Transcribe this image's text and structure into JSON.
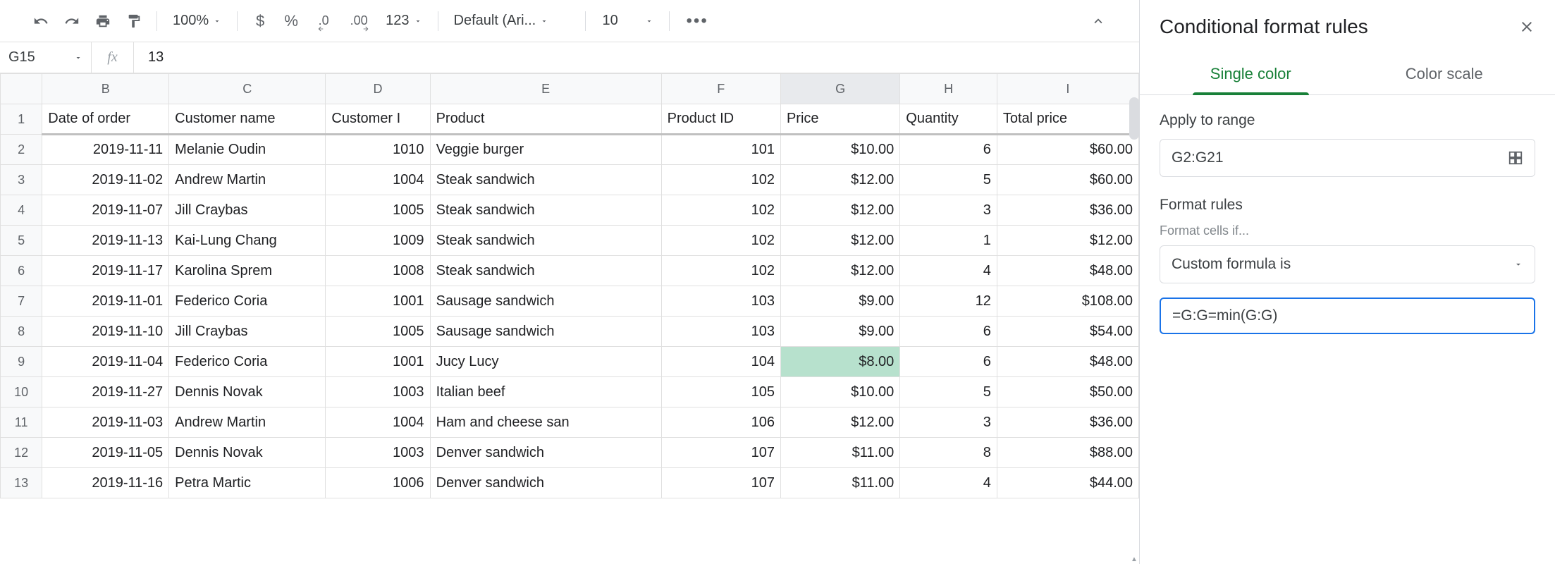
{
  "toolbar": {
    "zoom": "100%",
    "currency": "$",
    "percent": "%",
    "dec_decrease": ".0",
    "dec_increase": ".00",
    "format123": "123",
    "font": "Default (Ari...",
    "font_size": "10"
  },
  "name_box": "G15",
  "fx_label": "fx",
  "formula_value": "13",
  "columns": [
    "B",
    "C",
    "D",
    "E",
    "F",
    "G",
    "H",
    "I"
  ],
  "active_column": "G",
  "headers": [
    "Date of order",
    "Customer name",
    "Customer I",
    "Product",
    "Product ID",
    "Price",
    "Quantity",
    "Total price"
  ],
  "rows": [
    {
      "n": "1"
    },
    {
      "n": "2",
      "cells": [
        "2019-11-11",
        "Melanie Oudin",
        "1010",
        "Veggie burger",
        "101",
        "$10.00",
        "6",
        "$60.00"
      ]
    },
    {
      "n": "3",
      "cells": [
        "2019-11-02",
        "Andrew Martin",
        "1004",
        "Steak sandwich",
        "102",
        "$12.00",
        "5",
        "$60.00"
      ]
    },
    {
      "n": "4",
      "cells": [
        "2019-11-07",
        "Jill Craybas",
        "1005",
        "Steak sandwich",
        "102",
        "$12.00",
        "3",
        "$36.00"
      ]
    },
    {
      "n": "5",
      "cells": [
        "2019-11-13",
        "Kai-Lung Chang",
        "1009",
        "Steak sandwich",
        "102",
        "$12.00",
        "1",
        "$12.00"
      ]
    },
    {
      "n": "6",
      "cells": [
        "2019-11-17",
        "Karolina Sprem",
        "1008",
        "Steak sandwich",
        "102",
        "$12.00",
        "4",
        "$48.00"
      ]
    },
    {
      "n": "7",
      "cells": [
        "2019-11-01",
        "Federico Coria",
        "1001",
        "Sausage sandwich",
        "103",
        "$9.00",
        "12",
        "$108.00"
      ]
    },
    {
      "n": "8",
      "cells": [
        "2019-11-10",
        "Jill Craybas",
        "1005",
        "Sausage sandwich",
        "103",
        "$9.00",
        "6",
        "$54.00"
      ]
    },
    {
      "n": "9",
      "cells": [
        "2019-11-04",
        "Federico Coria",
        "1001",
        "Jucy Lucy",
        "104",
        "$8.00",
        "6",
        "$48.00"
      ],
      "highlight_col": 5
    },
    {
      "n": "10",
      "cells": [
        "2019-11-27",
        "Dennis Novak",
        "1003",
        "Italian beef",
        "105",
        "$10.00",
        "5",
        "$50.00"
      ]
    },
    {
      "n": "11",
      "cells": [
        "2019-11-03",
        "Andrew Martin",
        "1004",
        "Ham and cheese san",
        "106",
        "$12.00",
        "3",
        "$36.00"
      ]
    },
    {
      "n": "12",
      "cells": [
        "2019-11-05",
        "Dennis Novak",
        "1003",
        "Denver sandwich",
        "107",
        "$11.00",
        "8",
        "$88.00"
      ]
    },
    {
      "n": "13",
      "cells": [
        "2019-11-16",
        "Petra Martic",
        "1006",
        "Denver sandwich",
        "107",
        "$11.00",
        "4",
        "$44.00"
      ]
    }
  ],
  "numeric_cols": [
    0,
    2,
    4,
    5,
    6,
    7
  ],
  "sidebar": {
    "title": "Conditional format rules",
    "tabs": {
      "single": "Single color",
      "scale": "Color scale"
    },
    "apply_label": "Apply to range",
    "range": "G2:G21",
    "rules_label": "Format rules",
    "cells_if": "Format cells if...",
    "condition": "Custom formula is",
    "formula": "=G:G=min(G:G)"
  }
}
